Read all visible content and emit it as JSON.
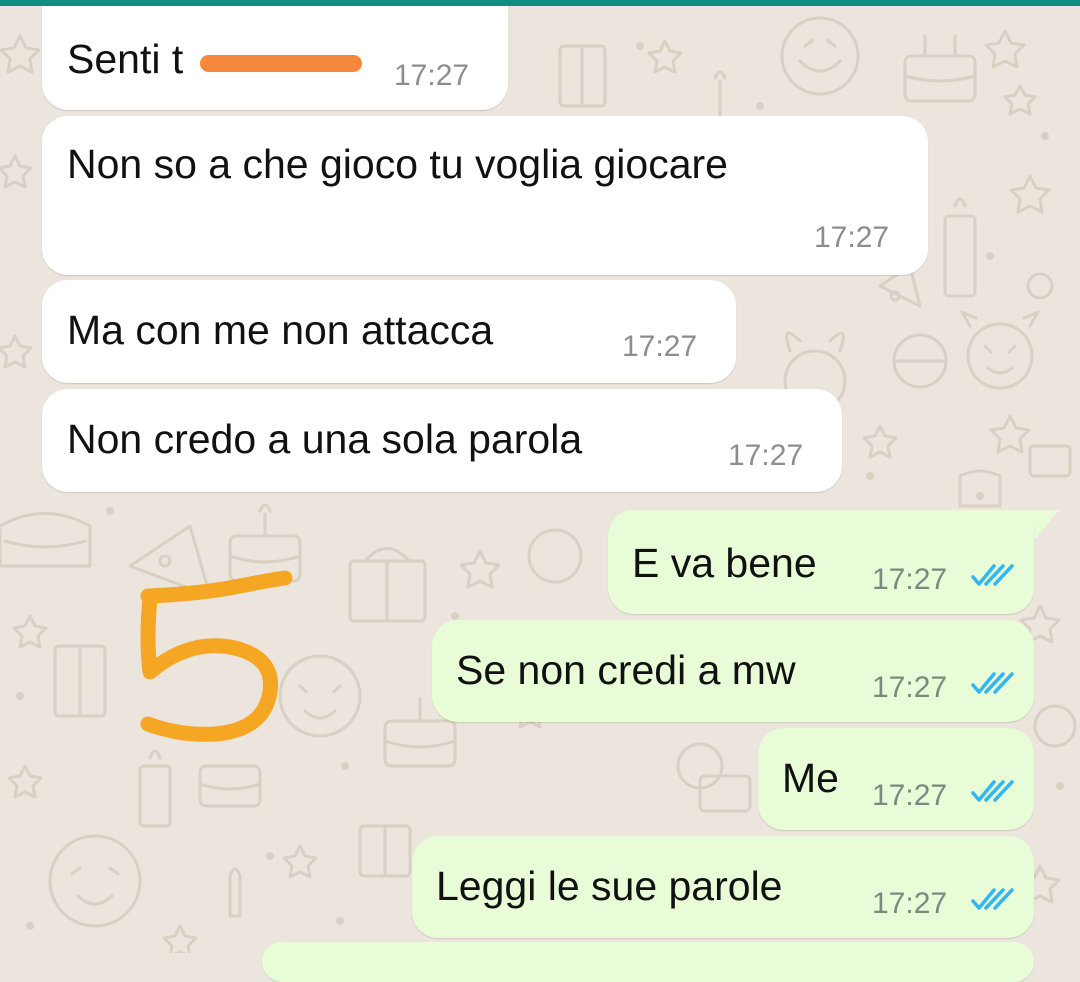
{
  "chat": {
    "incoming": [
      {
        "text": "Senti t",
        "time": "17:27"
      },
      {
        "text": "Non so a che gioco tu voglia giocare",
        "time": "17:27"
      },
      {
        "text": "Ma con me non attacca",
        "time": "17:27"
      },
      {
        "text": "Non credo a una sola parola",
        "time": "17:27"
      }
    ],
    "outgoing": [
      {
        "text": "E va bene",
        "time": "17:27",
        "status": "read"
      },
      {
        "text": "Se non credi a mw",
        "time": "17:27",
        "status": "read"
      },
      {
        "text": "Me",
        "time": "17:27",
        "status": "read"
      },
      {
        "text": "Leggi le sue parole",
        "time": "17:27",
        "status": "read"
      }
    ]
  },
  "annotation": {
    "text": "5",
    "color": "#f5a623"
  },
  "redaction": {
    "color": "#f5883a"
  },
  "colors": {
    "header": "#128c7e",
    "background": "#ece5dd",
    "incoming_bubble": "#ffffff",
    "outgoing_bubble": "#e7fcd7",
    "read_ticks": "#34b7f1",
    "timestamp": "#8a8f8c"
  },
  "icons": {
    "read_receipt": "double-check-icon",
    "wallpaper": "doodle-pattern"
  }
}
